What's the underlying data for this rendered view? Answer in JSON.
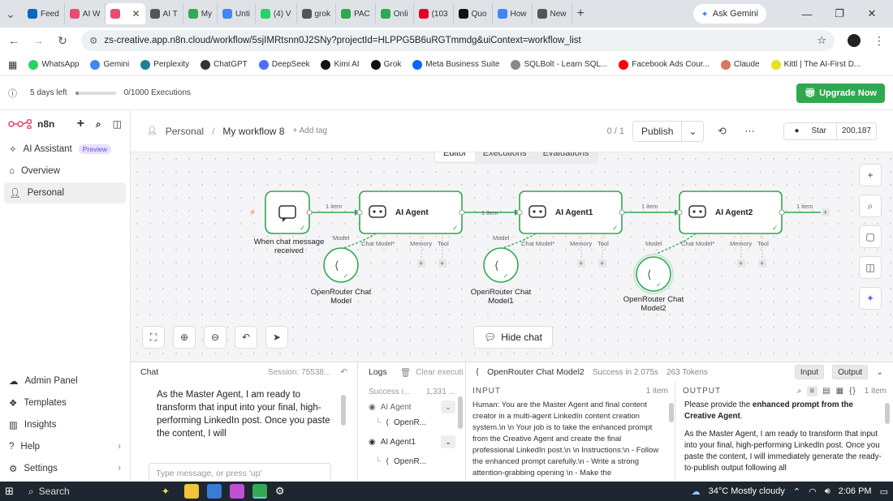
{
  "browser": {
    "tabs": [
      {
        "label": "Feed",
        "color": "#0a66c2"
      },
      {
        "label": "AI W",
        "color": "#ea4b71"
      },
      {
        "label": "",
        "color": "#ea4b71",
        "active": true
      },
      {
        "label": "AI T",
        "color": "#555555"
      },
      {
        "label": "My",
        "color": "#34a853"
      },
      {
        "label": "Unti",
        "color": "#4285f4"
      },
      {
        "label": "(4) V",
        "color": "#25d366"
      },
      {
        "label": "grok",
        "color": "#555555"
      },
      {
        "label": "PAC",
        "color": "#2fa84f"
      },
      {
        "label": "Onli",
        "color": "#2fa84f"
      },
      {
        "label": "(103",
        "color": "#e60023"
      },
      {
        "label": "Quo",
        "color": "#111111"
      },
      {
        "label": "How",
        "color": "#4285f4"
      },
      {
        "label": "New",
        "color": "#555555"
      }
    ],
    "ask_gemini": "Ask Gemini",
    "url": "zs-creative.app.n8n.cloud/workflow/5sjIMRtsnn0J2SNy?projectId=HLPPG5B6uRGTmmdg&uiContext=workflow_list",
    "bookmarks": [
      {
        "label": "WhatsApp",
        "color": "#25d366"
      },
      {
        "label": "Gemini",
        "color": "#4285f4"
      },
      {
        "label": "Perplexity",
        "color": "#20808d"
      },
      {
        "label": "ChatGPT",
        "color": "#333333"
      },
      {
        "label": "DeepSeek",
        "color": "#4d6bfe"
      },
      {
        "label": "Kimi AI",
        "color": "#111111"
      },
      {
        "label": "Grok",
        "color": "#111111"
      },
      {
        "label": "Meta Business Suite",
        "color": "#0866ff"
      },
      {
        "label": "SQLBolt - Learn SQL...",
        "color": "#888888"
      },
      {
        "label": "Facebook Ads Cour...",
        "color": "#ff0000"
      },
      {
        "label": "Claude",
        "color": "#d97757"
      },
      {
        "label": "Kittl | The AI-First D...",
        "color": "#e8e020"
      }
    ]
  },
  "trial": {
    "days_left": "5 days left",
    "executions": "0/1000 Executions",
    "progress": 0.08,
    "upgrade": "Upgrade Now"
  },
  "sidebar": {
    "brand": "n8n",
    "items": [
      {
        "label": "AI Assistant",
        "badge": "Preview"
      },
      {
        "label": "Overview"
      },
      {
        "label": "Personal"
      }
    ],
    "bottom_items": [
      {
        "label": "Admin Panel"
      },
      {
        "label": "Templates"
      },
      {
        "label": "Insights"
      },
      {
        "label": "Help"
      },
      {
        "label": "Settings"
      }
    ]
  },
  "header": {
    "project": "Personal",
    "workflow_name": "My workflow 8",
    "add_tag": "+ Add tag",
    "counter": "0 / 1",
    "publish": "Publish",
    "star": "Star",
    "star_count": "200,187"
  },
  "canvas": {
    "tabs": [
      "Editor",
      "Executions",
      "Evaluations"
    ],
    "trigger_label_1": "When chat message",
    "trigger_label_2": "received",
    "agents": [
      "AI Agent",
      "AI Agent1",
      "AI Agent2"
    ],
    "models": [
      {
        "line1": "OpenRouter Chat",
        "line2": "Model"
      },
      {
        "line1": "OpenRouter Chat",
        "line2": "Model1"
      },
      {
        "line1": "OpenRouter Chat",
        "line2": "Model2"
      }
    ],
    "edge_label": "1 item",
    "port_model": "Model",
    "port_chat_model": "Chat Model*",
    "port_memory": "Memory",
    "port_tool": "Tool",
    "hide_chat": "Hide chat",
    "colors": {
      "success": "#2fa84f",
      "node_border": "#2fa84f"
    }
  },
  "panel": {
    "chat_title": "Chat",
    "session": "Session: 75538...",
    "chat_message": "As the Master Agent, I am ready to transform that input into your final, high-performing LinkedIn post. Once you paste the content, I will",
    "chat_placeholder": "Type message, or press 'up'",
    "logs_title": "Logs",
    "clear_label": "Clear executi",
    "success_short": "Success i...",
    "success_count": "1,331 ...",
    "log_items": [
      "AI Agent",
      "OpenR...",
      "AI Agent1",
      "OpenR..."
    ],
    "node_name": "OpenRouter Chat Model2",
    "success_detail": "Success in 2.075s",
    "tokens": "263 Tokens",
    "input_btn": "Input",
    "output_btn": "Output",
    "input_title": "INPUT",
    "input_count": "1 item",
    "input_text": "Human: You are the Master Agent and final content creator in a multi-agent LinkedIn content creation system.\\n \\n Your job is to take the enhanced prompt from the Creative Agent and create the final professional LinkedIn post.\\n \\n Instructions:\\n - Follow the enhanced prompt carefully.\\n - Write a strong attention-grabbing opening \\n - Make the",
    "output_title": "OUTPUT",
    "output_count": "1 item",
    "output_p1_pre": "Please provide the ",
    "output_p1_bold": "enhanced prompt from the Creative Agent",
    "output_p1_post": ".",
    "output_p2": "As the Master Agent, I am ready to transform that input into your final, high-performing LinkedIn post. Once you paste the content, I will immediately generate the ready-to-publish output following all"
  },
  "taskbar": {
    "search": "Search",
    "weather": "34°C  Mostly cloudy",
    "time": "2:06 PM"
  }
}
